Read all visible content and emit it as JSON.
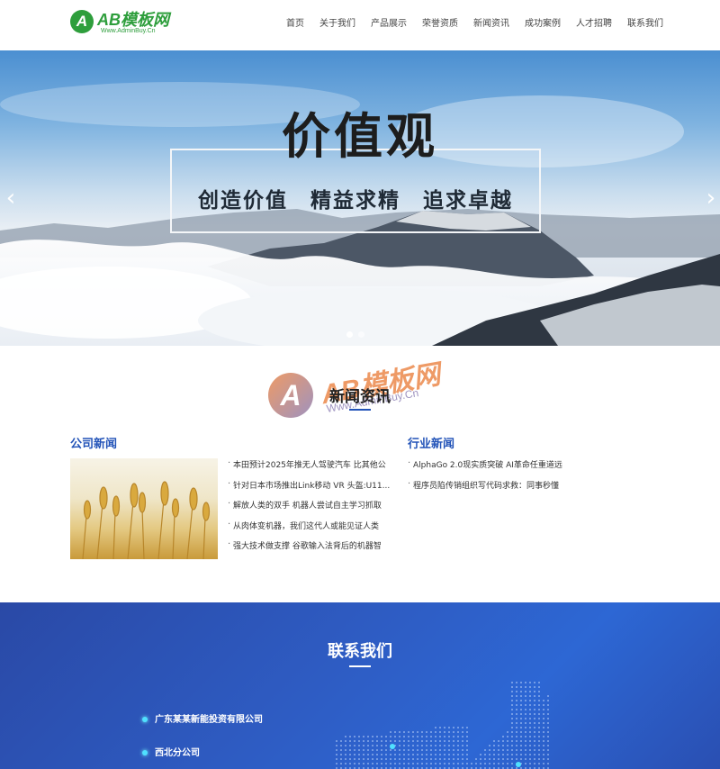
{
  "brand": {
    "logo_letter": "A",
    "name": "AB模板网",
    "url_text": "Www.AdminBuy.Cn"
  },
  "nav": [
    "首页",
    "关于我们",
    "产品展示",
    "荣誉资质",
    "新闻资讯",
    "成功案例",
    "人才招聘",
    "联系我们"
  ],
  "banner": {
    "title": "价值观",
    "subtitle": "创造价值　精益求精　追求卓越",
    "prev_icon": "chevron-left-icon",
    "next_icon": "chevron-right-icon",
    "slide_count": 2,
    "active_slide": 1
  },
  "news": {
    "title": "新闻资讯",
    "watermark": {
      "letter": "A",
      "name": "AB模板网",
      "url": "Www.AdminBuy.Cn"
    },
    "company": {
      "title": "公司新闻",
      "items": [
        "本田预计2025年推无人驾驶汽车 比其他公",
        "针对日本市场推出Link移动 VR 头盔:U11...",
        "解放人类的双手 机器人尝试自主学习抓取",
        "从肉体变机器，我们这代人或能见证人类",
        "强大技术做支撑 谷歌输入法背后的机器智"
      ]
    },
    "industry": {
      "title": "行业新闻",
      "items": [
        "AlphaGo 2.0现实质突破 AI革命任重道远",
        "程序员陷传销组织写代码求救：同事秒懂"
      ]
    }
  },
  "contact": {
    "title": "联系我们",
    "offices": [
      "广东某某新能投资有限公司",
      "西北分公司"
    ],
    "accent": "#4fe0ff"
  },
  "colors": {
    "brand_green": "#2e9e3c",
    "accent_blue": "#2253b8",
    "contact_bg": "#2e5cc3"
  }
}
